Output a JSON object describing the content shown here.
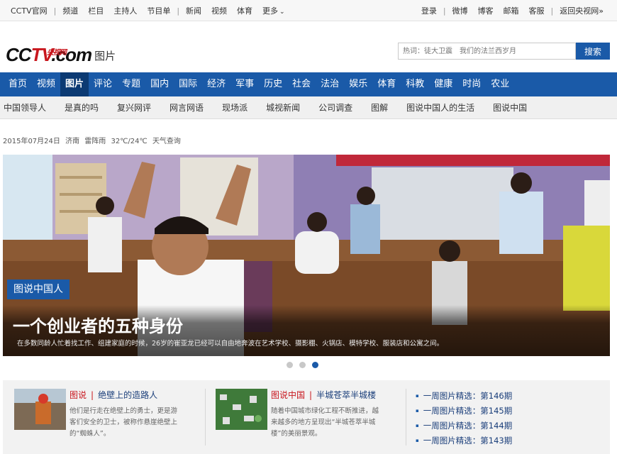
{
  "topbar": {
    "left_links": [
      "CCTV官网",
      "频道",
      "栏目",
      "主持人",
      "节目单",
      "新闻",
      "视频",
      "体育",
      "更多"
    ],
    "more_arrow": "⌄",
    "right_links": [
      "登录",
      "微博",
      "博客",
      "邮箱",
      "客服",
      "返回央视网"
    ],
    "return_arrow": "»"
  },
  "header": {
    "logo_cc": "CC",
    "logo_tv": "TV",
    "logo_com": ".com",
    "logo_sub": "央视网",
    "channel": "图片",
    "search_placeholder": "热词：徒大卫震　我们的法兰西岁月",
    "search_button": "搜索"
  },
  "mainnav": [
    "首页",
    "视频",
    "图片",
    "评论",
    "专题",
    "国内",
    "国际",
    "经济",
    "军事",
    "历史",
    "社会",
    "法治",
    "娱乐",
    "体育",
    "科教",
    "健康",
    "时尚",
    "农业"
  ],
  "mainnav_active": "图片",
  "subnav": [
    "中国领导人",
    "是真的吗",
    "复兴网评",
    "网言网语",
    "现场派",
    "城视新闻",
    "公司调查",
    "图解",
    "图说中国人的生活",
    "图说中国"
  ],
  "dateline": {
    "date": "2015年07月24日",
    "city": "济南",
    "weather": "雷阵雨",
    "temp": "32℃/24℃",
    "link": "天气查询"
  },
  "hero": {
    "tag": "图说中国人",
    "headline": "一个创业者的五种身份",
    "summary": "在多数同龄人忙着找工作、组建家庭的时候，26岁的崔亚龙已经可以自由地奔波在艺术学校、摄影棚、火锅店、模特学校、服装店和公寓之间。",
    "slide_count": 3,
    "active_slide": 3
  },
  "cards": [
    {
      "category": "图说",
      "title": "绝壁上的造路人",
      "desc_lines": [
        "他们是行走在绝壁上的勇士，更是游",
        "客们安全的卫士，被称作悬崖绝壁上",
        "的“蜘蛛人”。"
      ]
    },
    {
      "category": "图说中国",
      "title": "半城苍萃半城楼",
      "desc_lines": [
        "随着中国城市绿化工程不断推进，越",
        "来越多的地方呈现出“半城苍萃半城",
        "楼”的美丽景观。"
      ]
    }
  ],
  "weekly": [
    "一周图片精选：第146期",
    "一周图片精选：第145期",
    "一周图片精选：第144期",
    "一周图片精选：第143期"
  ],
  "colors": {
    "brand_blue": "#1a5aa8",
    "brand_red": "#c8161d",
    "nav_active": "#0c3a73"
  }
}
